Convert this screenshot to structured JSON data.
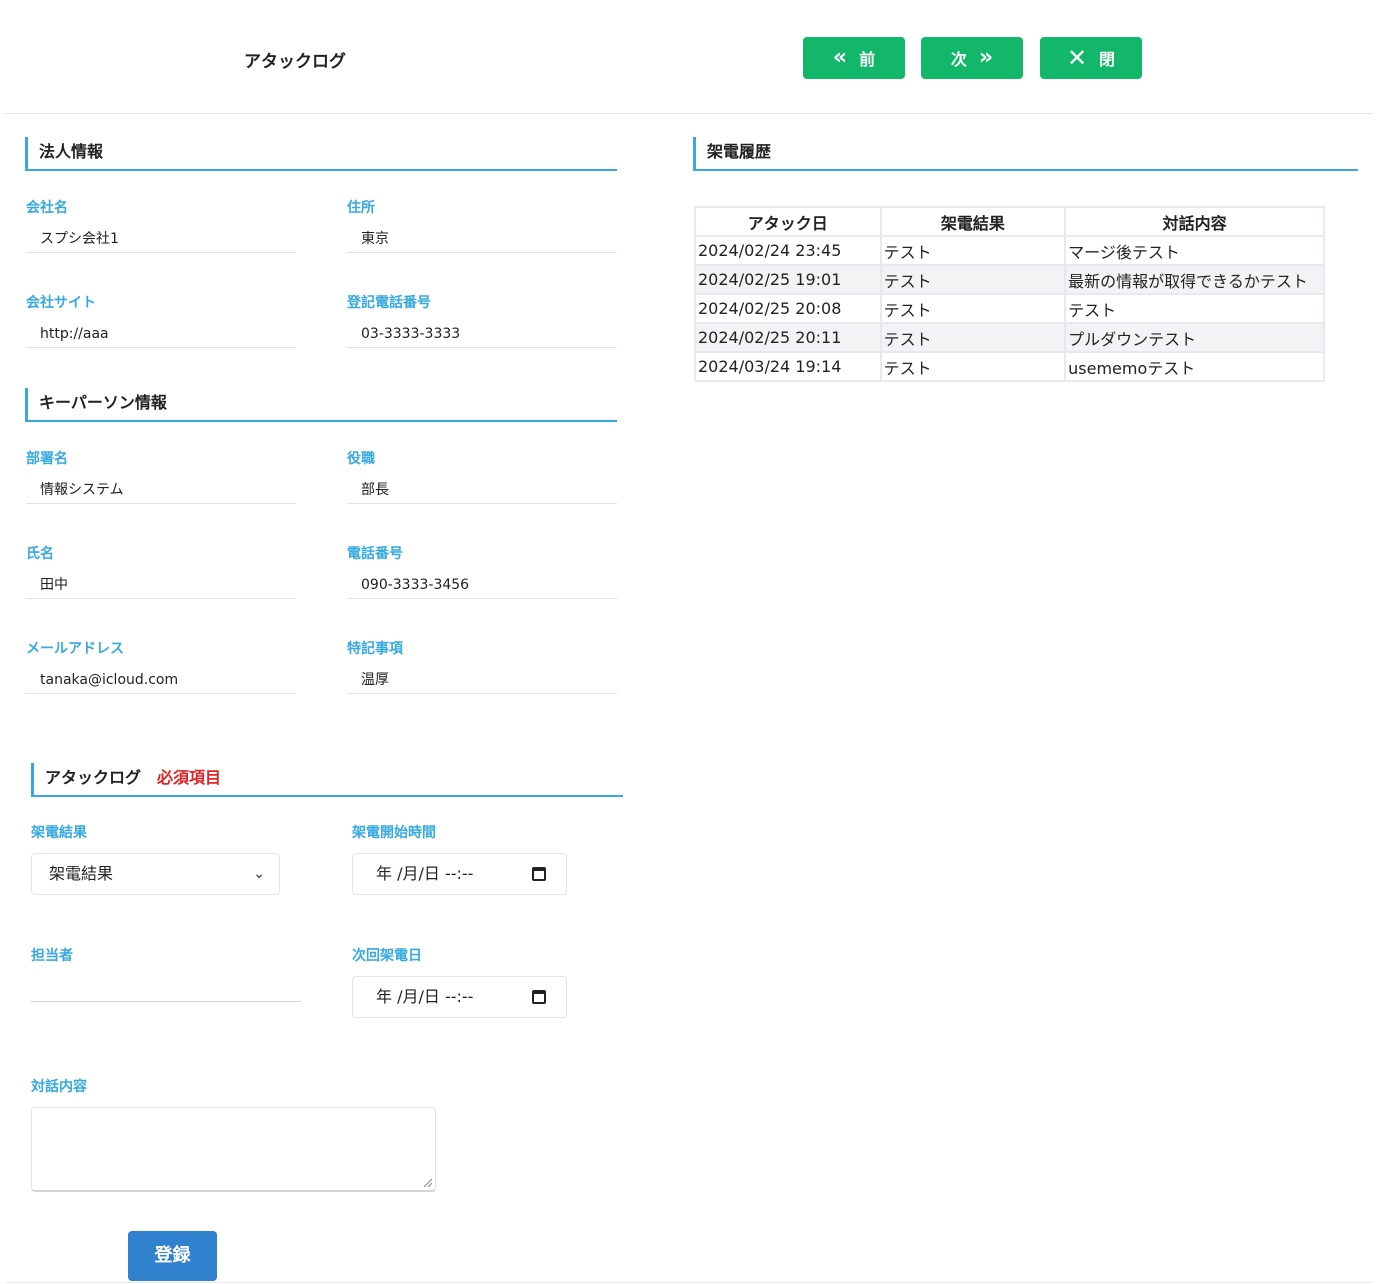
{
  "header": {
    "title": "アタックログ",
    "prev_label": "前",
    "next_label": "次",
    "close_label": "閉"
  },
  "corp": {
    "heading": "法人情報",
    "company_label": "会社名",
    "company_value": "スプシ会社1",
    "address_label": "住所",
    "address_value": "東京",
    "site_label": "会社サイト",
    "site_value": "http://aaa",
    "phone_label": "登記電話番号",
    "phone_value": "03-3333-3333"
  },
  "keyperson": {
    "heading": "キーパーソン情報",
    "dept_label": "部署名",
    "dept_value": "情報システム",
    "role_label": "役職",
    "role_value": "部長",
    "name_label": "氏名",
    "name_value": "田中",
    "tel_label": "電話番号",
    "tel_value": "090-3333-3456",
    "mail_label": "メールアドレス",
    "mail_value": "tanaka@icloud.com",
    "note_label": "特記事項",
    "note_value": "温厚"
  },
  "attack": {
    "heading": "アタックログ",
    "required": "必須項目",
    "result_label": "架電結果",
    "result_selected": "架電結果",
    "start_label": "架電開始時間",
    "start_placeholder": "年 /月/日 --:--",
    "owner_label": "担当者",
    "next_label": "次回架電日",
    "next_placeholder": "年 /月/日 --:--",
    "talk_label": "対話内容",
    "submit_label": "登録"
  },
  "history": {
    "heading": "架電履歴",
    "columns": [
      "アタック日",
      "架電結果",
      "対話内容"
    ],
    "rows": [
      [
        "2024/02/24 23:45",
        "テスト",
        "マージ後テスト"
      ],
      [
        "2024/02/25 19:01",
        "テスト",
        "最新の情報が取得できるかテスト"
      ],
      [
        "2024/02/25 20:08",
        "テスト",
        "テスト"
      ],
      [
        "2024/02/25 20:11",
        "テスト",
        "プルダウンテスト"
      ],
      [
        "2024/03/24 19:14",
        "テスト",
        "usememoテスト"
      ]
    ]
  },
  "colors": {
    "accent": "#36a9e1",
    "header_button": "#12b76a",
    "submit_button": "#3182ce",
    "required": "#e02424"
  }
}
